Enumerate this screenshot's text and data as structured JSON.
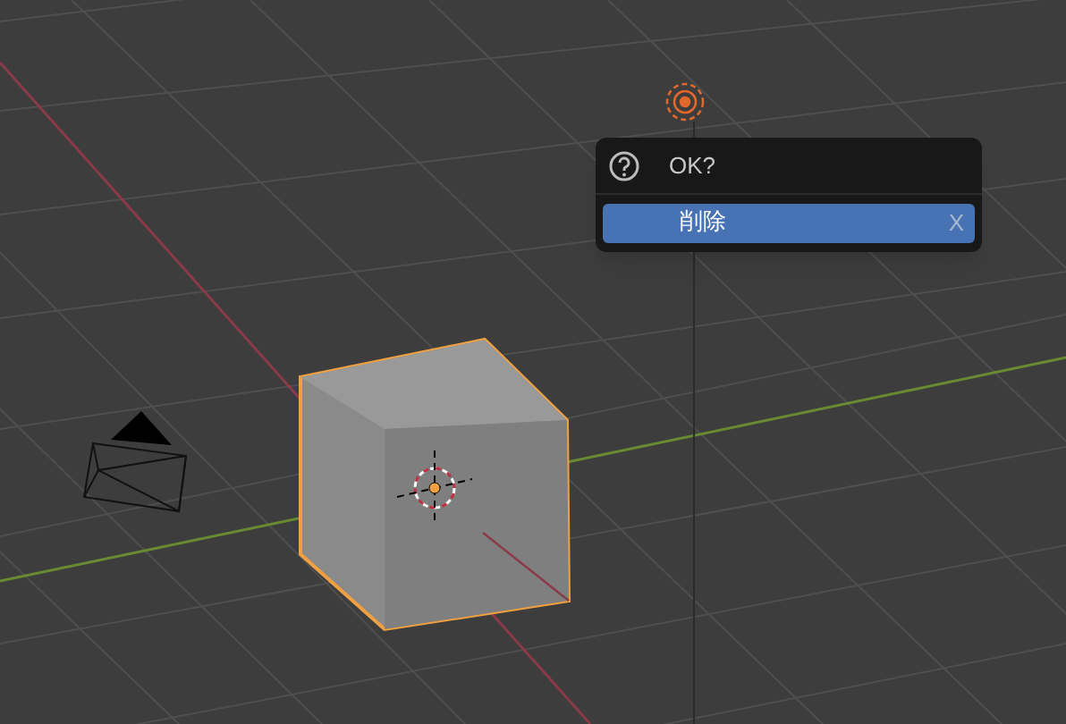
{
  "dialog": {
    "title": "OK?",
    "items": [
      {
        "label": "削除",
        "shortcut": "X",
        "selected": true
      }
    ]
  }
}
